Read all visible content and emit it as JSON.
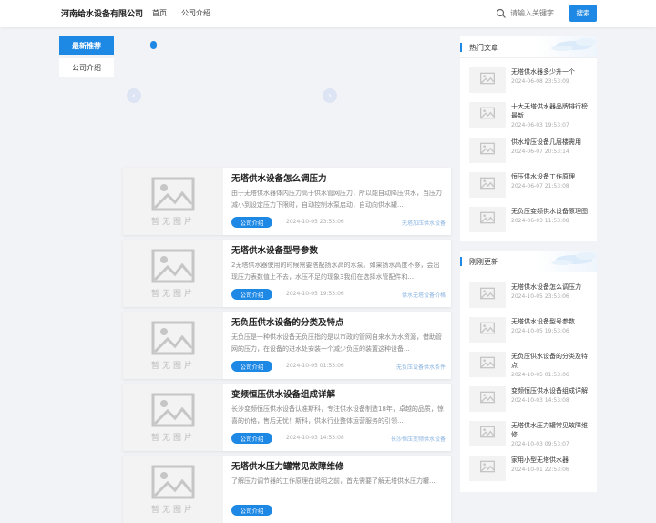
{
  "header": {
    "logo": "河南给水设备有限公司",
    "nav": [
      "首页",
      "公司介绍"
    ],
    "search_placeholder": "请输入关键字",
    "search_button": "搜索"
  },
  "leftnav": {
    "active": "最新推荐",
    "item": "公司介绍"
  },
  "slider": {
    "prev_icon": "chevron-left-icon",
    "next_icon": "chevron-right-icon"
  },
  "placeholder_text": "暂无图片",
  "posts": [
    {
      "title": "无塔供水设备怎么调压力",
      "desc": "由于无塔供水器体内压力高于供水管网压力，所以能自动降压供水，当压力减小到设定压力下限时，自动控制水泵启动，自动向供水罐...",
      "category": "公司介绍",
      "date": "2024-10-05 23:53:06",
      "tag": "无塔加压供水设备"
    },
    {
      "title": "无塔供水设备型号参数",
      "desc": "2无塔供水器使用的时候需要搭配扬水高的水泵。如果扬水高度不够，会出现压力表数值上不去，水压不足的现象3我们在选择水管配件和...",
      "category": "公司介绍",
      "date": "2024-10-05 19:53:06",
      "tag": "供水无塔设备价格"
    },
    {
      "title": "无负压供水设备的分类及特点",
      "desc": "无负压是一种供水设备无负压指的是以市政的管网自来水为水资源，借助管网的压力，在设备的进水处安装一个减少负压的装置这种设备...",
      "category": "公司介绍",
      "date": "2024-10-05 01:53:06",
      "tag": "无负压设备供水条件"
    },
    {
      "title": "变频恒压供水设备组成详解",
      "desc": "长沙变频恒压供水设备认准斯科，专注供水设备制造18年，卓越的品质，惊喜的价格，售后无忧！斯科，供水行业整体运营服务的引领...",
      "category": "公司介绍",
      "date": "2024-10-03 14:53:08",
      "tag": "长沙恒压变频供水设备"
    },
    {
      "title": "无塔供水压力罐常见故障维修",
      "desc": "了解压力调节器的工作原理在说明之前，首先需要了解无塔供水压力罐...",
      "category": "公司介绍",
      "date": "",
      "tag": ""
    }
  ],
  "hot": {
    "title": "热门文章",
    "items": [
      {
        "title": "无塔供水器多少升一个",
        "date": "2024-06-08 23:53:09"
      },
      {
        "title": "十大无塔供水器品牌排行榜最新",
        "date": "2024-06-03 19:53:07"
      },
      {
        "title": "供水增压设备几层楼需用",
        "date": "2024-06-07 20:53:14"
      },
      {
        "title": "恒压供水设备工作原理",
        "date": "2024-06-07 21:53:08"
      },
      {
        "title": "无负压变频供水设备原理图",
        "date": "2024-06-03 11:53:08"
      }
    ]
  },
  "recent": {
    "title": "刚刚更新",
    "items": [
      {
        "title": "无塔供水设备怎么调压力",
        "date": "2024-10-05 23:53:06"
      },
      {
        "title": "无塔供水设备型号参数",
        "date": "2024-10-05 19:53:06"
      },
      {
        "title": "无负压供水设备的分类及特点",
        "date": "2024-10-05 01:53:06"
      },
      {
        "title": "变频恒压供水设备组成详解",
        "date": "2024-10-03 14:53:08"
      },
      {
        "title": "无塔供水压力罐常见故障维修",
        "date": "2024-10-03 09:53:07"
      },
      {
        "title": "家用小型无塔供水器",
        "date": "2024-10-01 22:53:06"
      }
    ]
  },
  "colors": {
    "accent": "#1e88e5",
    "bg": "#f2f3f6"
  }
}
